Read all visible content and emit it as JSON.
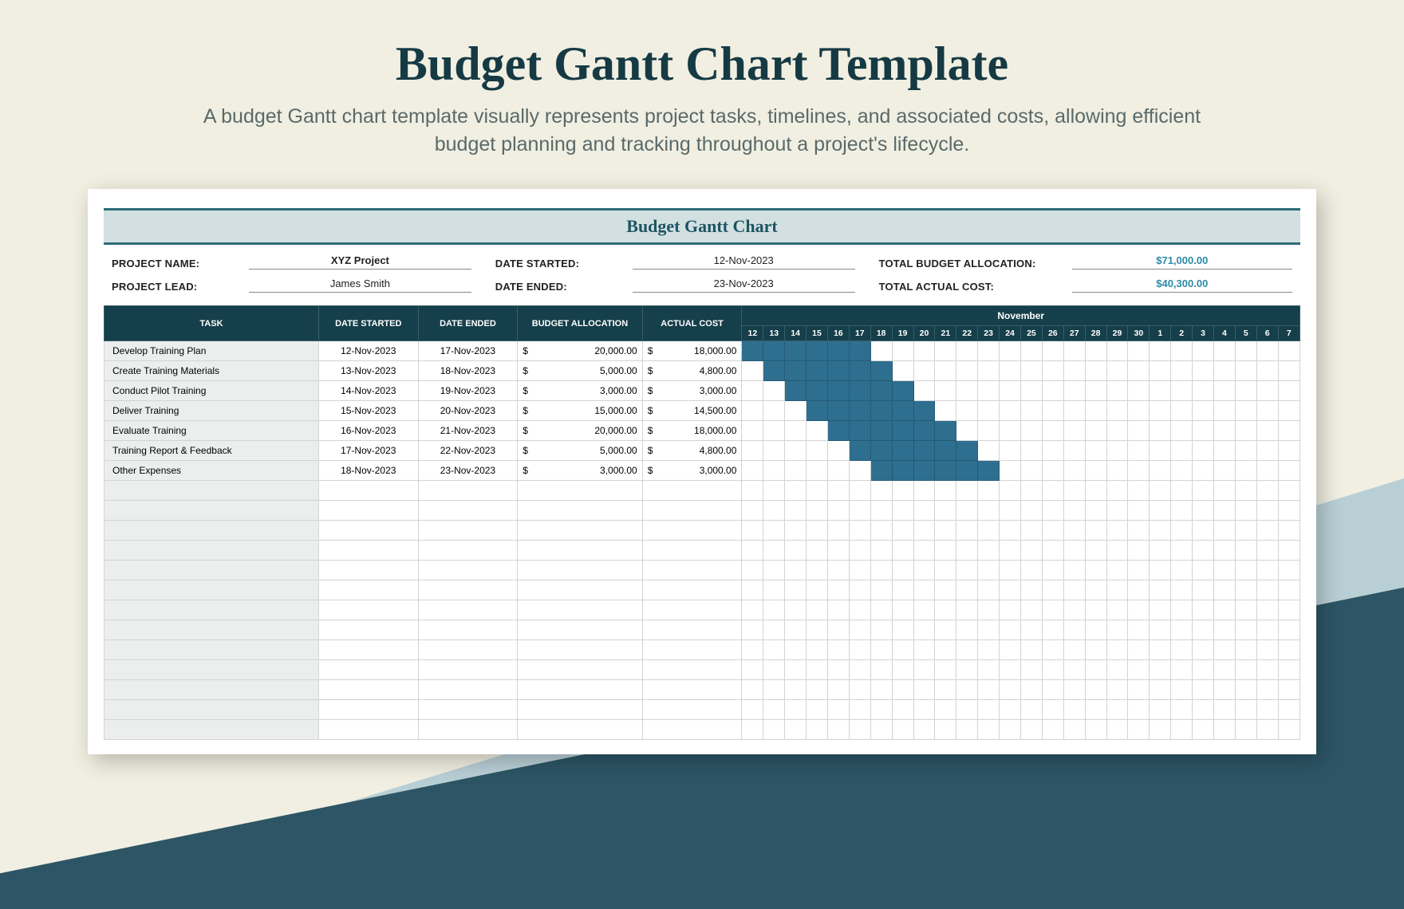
{
  "page": {
    "title": "Budget Gantt Chart Template",
    "subtitle": "A budget Gantt chart template visually represents project tasks, timelines, and associated costs, allowing efficient budget planning and tracking throughout a project's lifecycle."
  },
  "banner": "Budget Gantt Chart",
  "meta": {
    "labels": {
      "project_name": "PROJECT NAME:",
      "project_lead": "PROJECT LEAD:",
      "date_started": "DATE STARTED:",
      "date_ended": "DATE ENDED:",
      "total_budget": "TOTAL BUDGET ALLOCATION:",
      "total_actual": "TOTAL ACTUAL COST:"
    },
    "values": {
      "project_name": "XYZ Project",
      "project_lead": "James Smith",
      "date_started": "12-Nov-2023",
      "date_ended": "23-Nov-2023",
      "total_budget": "$71,000.00",
      "total_actual": "$40,300.00"
    }
  },
  "columns": {
    "task": "TASK",
    "date_started": "DATE STARTED",
    "date_ended": "DATE ENDED",
    "budget": "BUDGET ALLOCATION",
    "actual": "ACTUAL COST",
    "month": "November"
  },
  "currency": "$",
  "days": [
    "12",
    "13",
    "14",
    "15",
    "16",
    "17",
    "18",
    "19",
    "20",
    "21",
    "22",
    "23",
    "24",
    "25",
    "26",
    "27",
    "28",
    "29",
    "30",
    "1",
    "2",
    "3",
    "4",
    "5",
    "6",
    "7"
  ],
  "rows": [
    {
      "task": "Develop Training Plan",
      "start": "12-Nov-2023",
      "end": "17-Nov-2023",
      "budget": "20,000.00",
      "actual": "18,000.00",
      "from": 0,
      "to": 5
    },
    {
      "task": "Create Training Materials",
      "start": "13-Nov-2023",
      "end": "18-Nov-2023",
      "budget": "5,000.00",
      "actual": "4,800.00",
      "from": 1,
      "to": 6
    },
    {
      "task": "Conduct Pilot Training",
      "start": "14-Nov-2023",
      "end": "19-Nov-2023",
      "budget": "3,000.00",
      "actual": "3,000.00",
      "from": 2,
      "to": 7
    },
    {
      "task": "Deliver Training",
      "start": "15-Nov-2023",
      "end": "20-Nov-2023",
      "budget": "15,000.00",
      "actual": "14,500.00",
      "from": 3,
      "to": 8
    },
    {
      "task": "Evaluate Training",
      "start": "16-Nov-2023",
      "end": "21-Nov-2023",
      "budget": "20,000.00",
      "actual": "18,000.00",
      "from": 4,
      "to": 9
    },
    {
      "task": "Training Report & Feedback",
      "start": "17-Nov-2023",
      "end": "22-Nov-2023",
      "budget": "5,000.00",
      "actual": "4,800.00",
      "from": 5,
      "to": 10
    },
    {
      "task": "Other Expenses",
      "start": "18-Nov-2023",
      "end": "23-Nov-2023",
      "budget": "3,000.00",
      "actual": "3,000.00",
      "from": 6,
      "to": 11
    }
  ],
  "empty_rows": 13,
  "chart_data": {
    "type": "gantt",
    "title": "Budget Gantt Chart",
    "x_axis": {
      "label": "November",
      "start": "2023-11-12",
      "days": [
        "12",
        "13",
        "14",
        "15",
        "16",
        "17",
        "18",
        "19",
        "20",
        "21",
        "22",
        "23",
        "24",
        "25",
        "26",
        "27",
        "28",
        "29",
        "30",
        "1",
        "2",
        "3",
        "4",
        "5",
        "6",
        "7"
      ]
    },
    "series": [
      {
        "name": "Develop Training Plan",
        "start": "2023-11-12",
        "end": "2023-11-17",
        "budget_allocation": 20000,
        "actual_cost": 18000
      },
      {
        "name": "Create Training Materials",
        "start": "2023-11-13",
        "end": "2023-11-18",
        "budget_allocation": 5000,
        "actual_cost": 4800
      },
      {
        "name": "Conduct Pilot Training",
        "start": "2023-11-14",
        "end": "2023-11-19",
        "budget_allocation": 3000,
        "actual_cost": 3000
      },
      {
        "name": "Deliver Training",
        "start": "2023-11-15",
        "end": "2023-11-20",
        "budget_allocation": 15000,
        "actual_cost": 14500
      },
      {
        "name": "Evaluate Training",
        "start": "2023-11-16",
        "end": "2023-11-21",
        "budget_allocation": 20000,
        "actual_cost": 18000
      },
      {
        "name": "Training Report & Feedback",
        "start": "2023-11-17",
        "end": "2023-11-22",
        "budget_allocation": 5000,
        "actual_cost": 4800
      },
      {
        "name": "Other Expenses",
        "start": "2023-11-18",
        "end": "2023-11-23",
        "budget_allocation": 3000,
        "actual_cost": 3000
      }
    ],
    "totals": {
      "budget_allocation": 71000,
      "actual_cost": 40300
    }
  }
}
